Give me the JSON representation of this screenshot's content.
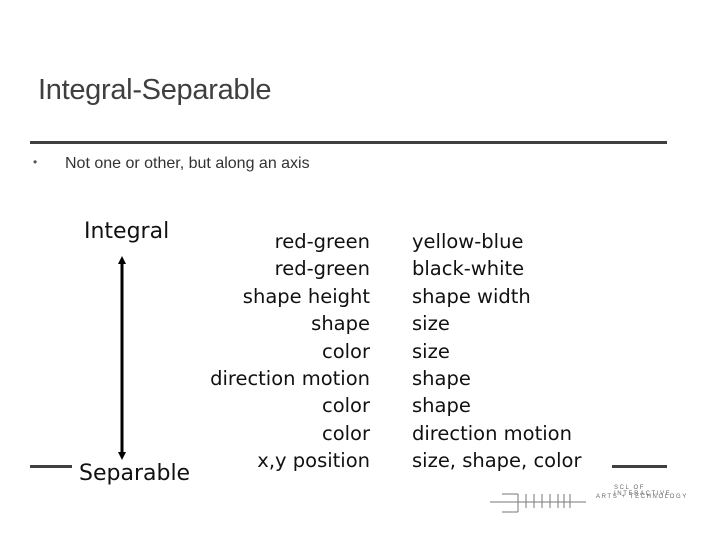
{
  "slide": {
    "title": "Integral-Separable",
    "bullets": [
      {
        "marker": "•",
        "text": "Not one or other, but along an axis"
      }
    ]
  },
  "axis": {
    "top_label": "Integral",
    "bottom_label": "Separable",
    "arrow_icon": "double-headed-vertical-arrow"
  },
  "pairs": [
    {
      "left": "red-green",
      "right": "yellow-blue"
    },
    {
      "left": "red-green",
      "right": "black-white"
    },
    {
      "left": "shape height",
      "right": "shape width"
    },
    {
      "left": "shape",
      "right": "size"
    },
    {
      "left": "color",
      "right": "size"
    },
    {
      "left": "direction motion",
      "right": "shape"
    },
    {
      "left": "color",
      "right": "shape"
    },
    {
      "left": "color",
      "right": "direction motion"
    },
    {
      "left": "x,y position",
      "right": "size, shape, color"
    }
  ],
  "footer": {
    "logo_line1": "SCL OF INTERACTIVE",
    "logo_line2": "ARTS + TECHNOLOGY",
    "logo_icon": "school-logo-mark"
  },
  "colors": {
    "title": "#3f3f3f",
    "rule": "#404040",
    "body_text": "#111111"
  }
}
